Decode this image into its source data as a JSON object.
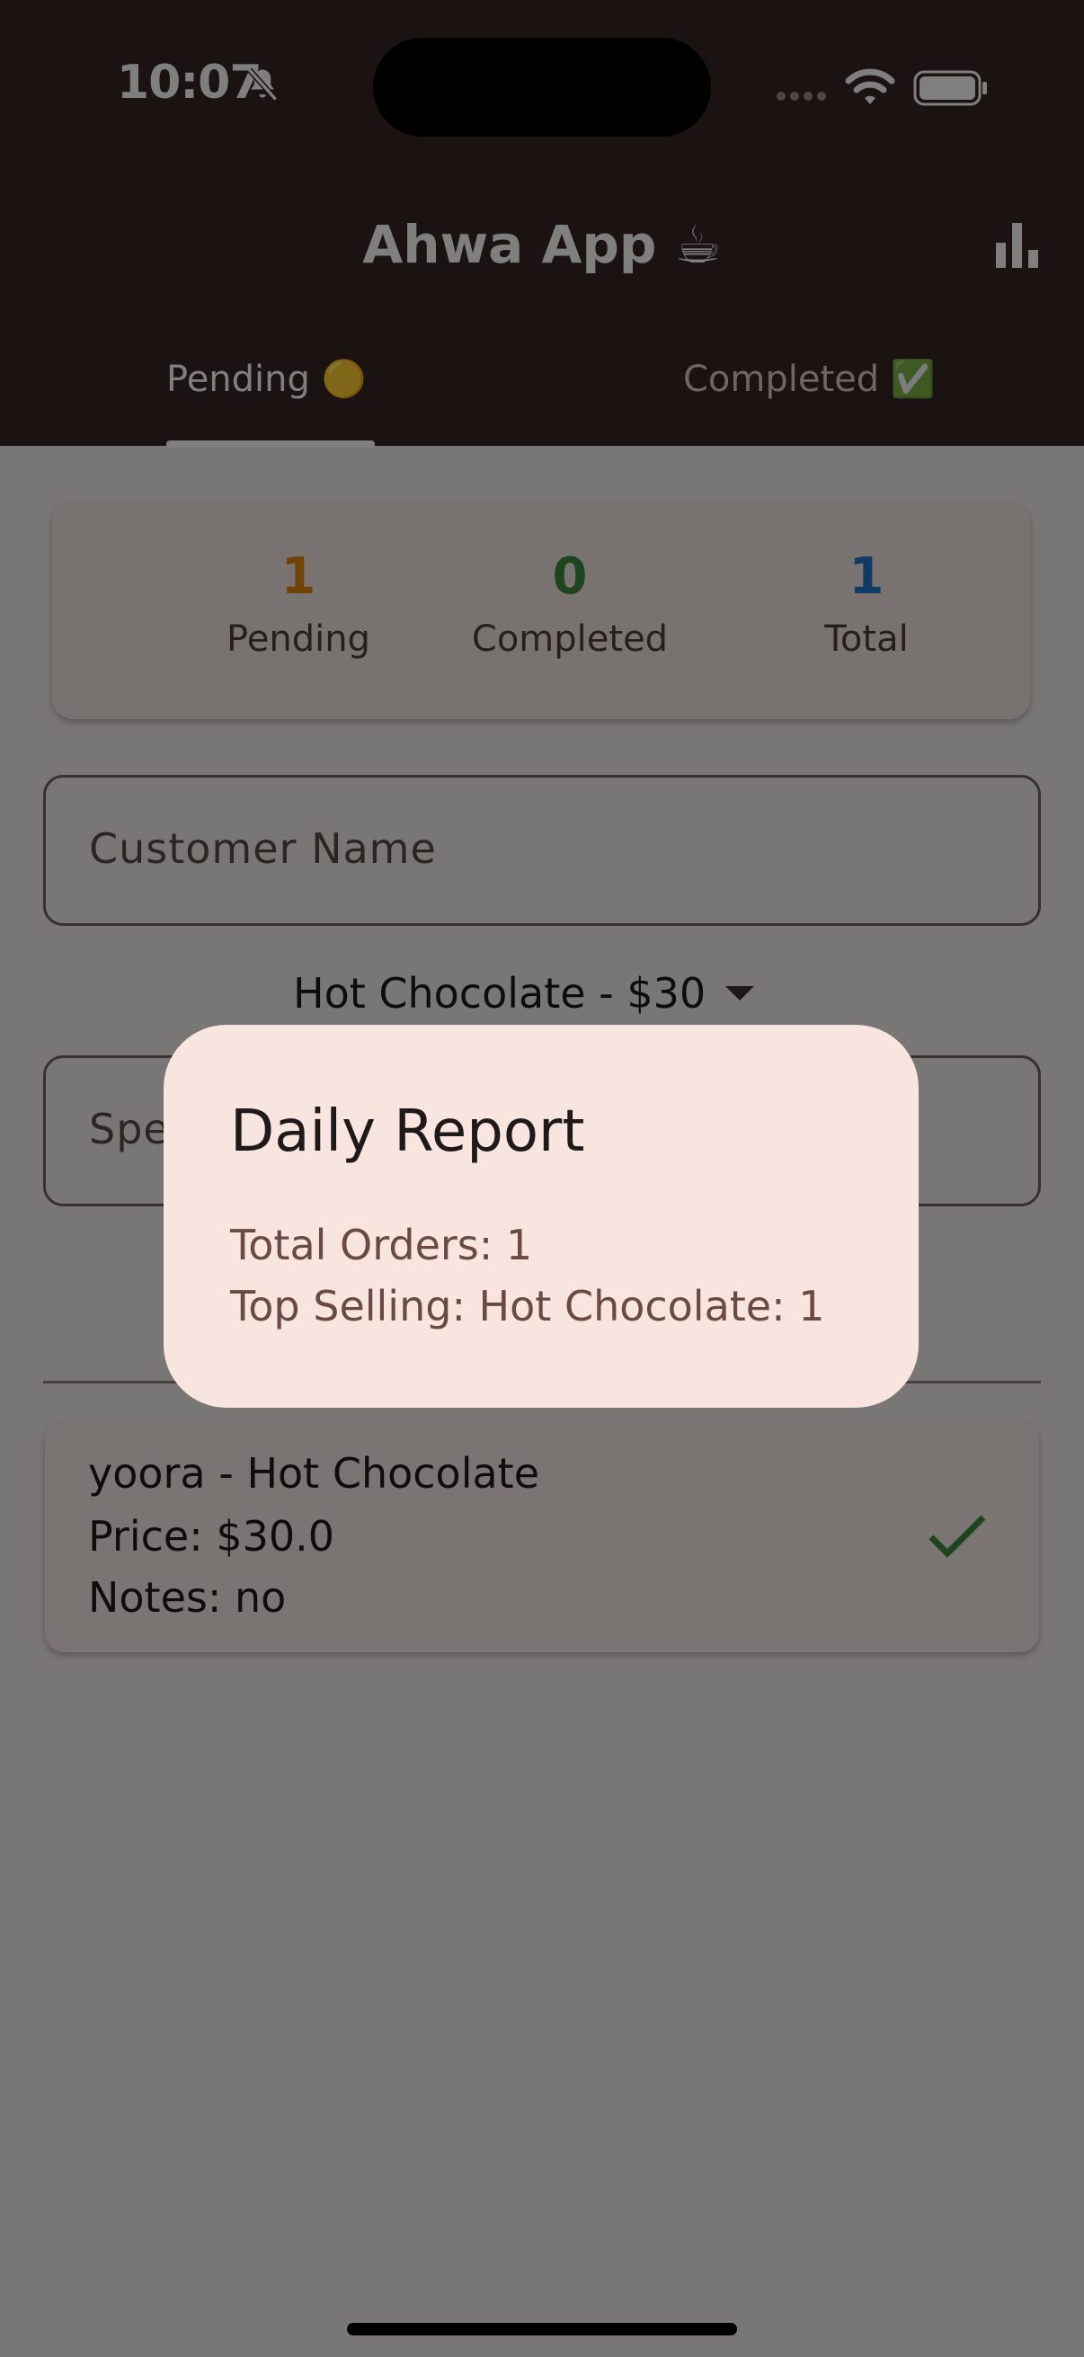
{
  "status_bar": {
    "time": "10:07"
  },
  "app_bar": {
    "title": "Ahwa App ☕",
    "tabs": [
      {
        "label": "Pending 🟡",
        "selected": true
      },
      {
        "label": "Completed ✅",
        "selected": false
      }
    ]
  },
  "stats": [
    {
      "value": "1",
      "label": "Pending",
      "color": "#e0860f"
    },
    {
      "value": "0",
      "label": "Completed",
      "color": "#3b8a3c"
    },
    {
      "value": "1",
      "label": "Total",
      "color": "#1f77c9"
    }
  ],
  "form": {
    "customer_name_label": "Customer Name",
    "drink_selected": "Hot Chocolate - $30",
    "special_label": "Spe"
  },
  "orders": [
    {
      "title": "yoora - Hot Chocolate",
      "price": "Price: $30.0",
      "notes": "Notes: no"
    }
  ],
  "dialog": {
    "title": "Daily Report",
    "total_orders": "Total Orders: 1",
    "top_selling": "Top Selling: Hot Chocolate: 1"
  },
  "icons": {
    "bell": "bell-slash-icon",
    "signal": "signal-icon",
    "wifi": "wifi-icon",
    "battery": "battery-icon",
    "report": "bar-chart-icon",
    "done": "check-icon"
  }
}
